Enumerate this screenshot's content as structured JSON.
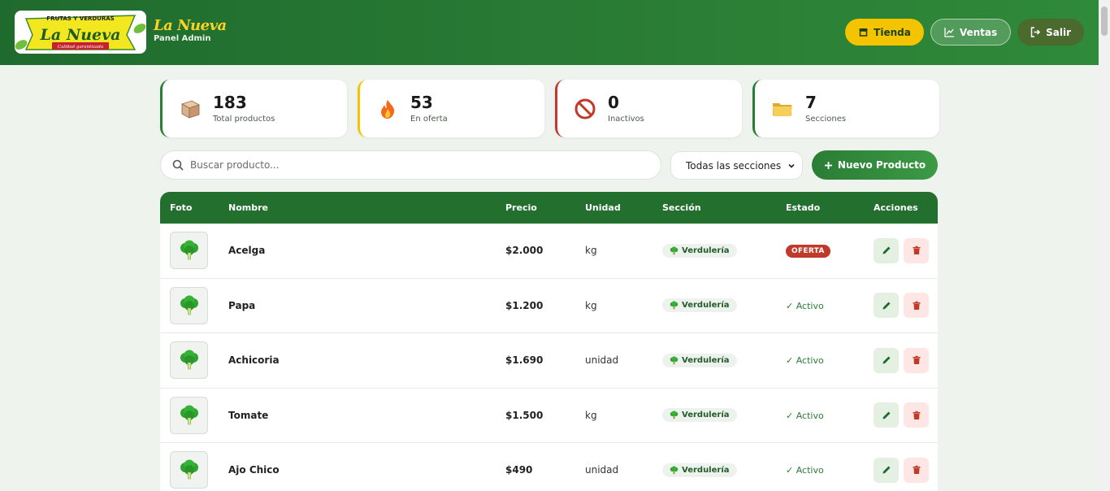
{
  "header": {
    "logo_top_text": "FRUTAS Y VERDURAS",
    "logo_script_text": "La Nueva",
    "logo_ribbon_text": "Calidad garantizada",
    "brand_name": "La Nueva",
    "brand_sub": "Panel Admin",
    "nav": [
      {
        "label": "Tienda",
        "icon": "store-icon"
      },
      {
        "label": "Ventas",
        "icon": "chart-line-icon"
      },
      {
        "label": "Salir",
        "icon": "logout-icon"
      }
    ]
  },
  "stats": [
    {
      "value": "183",
      "label": "Total productos",
      "icon": "box-icon"
    },
    {
      "value": "53",
      "label": "En oferta",
      "icon": "fire-icon"
    },
    {
      "value": "0",
      "label": "Inactivos",
      "icon": "prohibited-icon"
    },
    {
      "value": "7",
      "label": "Secciones",
      "icon": "folder-icon"
    }
  ],
  "toolbar": {
    "search_placeholder": "Buscar producto...",
    "section_select": "Todas las secciones",
    "new_product_label": "Nuevo Producto"
  },
  "table": {
    "columns": [
      "Foto",
      "Nombre",
      "Precio",
      "Unidad",
      "Sección",
      "Estado",
      "Acciones"
    ],
    "rows": [
      {
        "nombre": "Acelga",
        "precio": "$2.000",
        "unidad": "kg",
        "seccion": "Verdulería",
        "estado": "OFERTA"
      },
      {
        "nombre": "Papa",
        "precio": "$1.200",
        "unidad": "kg",
        "seccion": "Verdulería",
        "estado": "✓ Activo"
      },
      {
        "nombre": "Achicoria",
        "precio": "$1.690",
        "unidad": "unidad",
        "seccion": "Verdulería",
        "estado": "✓ Activo"
      },
      {
        "nombre": "Tomate",
        "precio": "$1.500",
        "unidad": "kg",
        "seccion": "Verdulería",
        "estado": "✓ Activo"
      },
      {
        "nombre": "Ajo Chico",
        "precio": "$490",
        "unidad": "unidad",
        "seccion": "Verdulería",
        "estado": "✓ Activo"
      }
    ]
  },
  "colors": {
    "primary_green": "#226f2e",
    "accent_yellow": "#f5c400",
    "danger_red": "#c0392b"
  }
}
